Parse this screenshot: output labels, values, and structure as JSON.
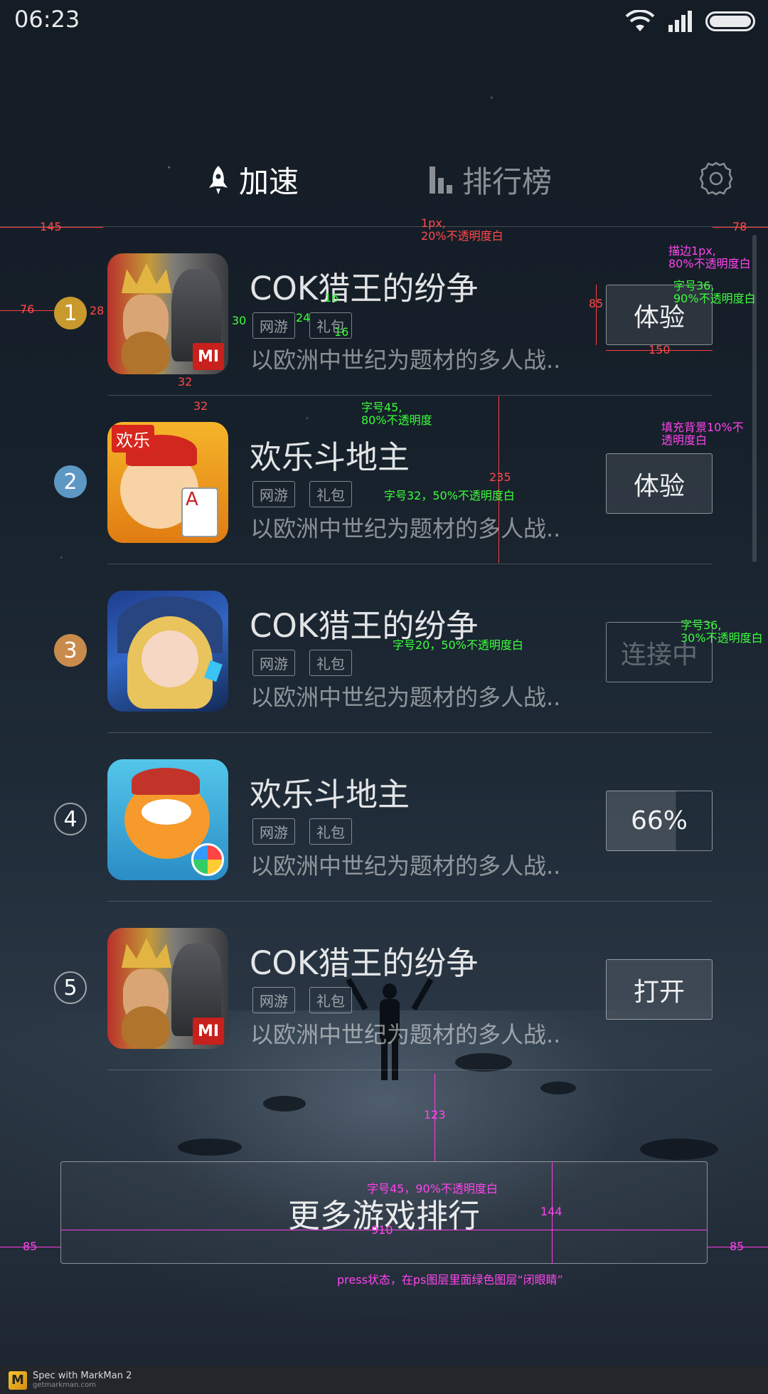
{
  "status_bar": {
    "time": "06:23"
  },
  "tabs": [
    {
      "label": "加速",
      "icon": "rocket-icon",
      "active": true
    },
    {
      "label": "排行榜",
      "icon": "bar-chart-icon",
      "active": false
    }
  ],
  "settings_icon": "gear-icon",
  "games": [
    {
      "rank": "1",
      "title": "COK猎王的纷争",
      "tags": [
        "网游",
        "礼包"
      ],
      "desc": "以欧洲中世纪为题材的多人战..",
      "button": "体验",
      "icon": "cok-game-icon"
    },
    {
      "rank": "2",
      "title": "欢乐斗地主",
      "tags": [
        "网游",
        "礼包"
      ],
      "desc": "以欧洲中世纪为题材的多人战..",
      "button": "体验",
      "icon": "doudizhu-game-icon"
    },
    {
      "rank": "3",
      "title": "COK猎王的纷争",
      "tags": [
        "网游",
        "礼包"
      ],
      "desc": "以欧洲中世纪为题材的多人战..",
      "button": "连接中",
      "icon": "hero-game-icon"
    },
    {
      "rank": "4",
      "title": "欢乐斗地主",
      "tags": [
        "网游",
        "礼包"
      ],
      "desc": "以欧洲中世纪为题材的多人战..",
      "button": "66%",
      "progress": 0.66,
      "icon": "cat-game-icon"
    },
    {
      "rank": "5",
      "title": "COK猎王的纷争",
      "tags": [
        "网游",
        "礼包"
      ],
      "desc": "以欧洲中世纪为题材的多人战..",
      "button": "打开",
      "icon": "cok-game-icon"
    }
  ],
  "more_button": "更多游戏排行",
  "annotations": {
    "m145": "145",
    "m1px": "1px,\n20%不透明度白",
    "m78": "78",
    "m_stroke": "描边1px,\n80%不透明度白",
    "m_font36_90": "字号36,\n90%不透明度白",
    "m85": "85",
    "m76": "76",
    "m28": "28",
    "m30": "30",
    "m24": "24",
    "m16a": "16",
    "m16b": "16",
    "m150": "150",
    "m32a": "32",
    "m32b": "32",
    "m_font45_80": "字号45,\n80%不透明度",
    "m_fill10": "填充背景10%不\n透明度白",
    "m235": "235",
    "m_font32_50": "字号32，50%不透明度白",
    "m_font20_50": "字号20，50%不透明度白",
    "m_font36_30": "字号36,\n30%不透明度白",
    "m123": "123",
    "m_font45_90": "字号45，90%不透明度白",
    "m144": "144",
    "m910": "910",
    "m85l": "85",
    "m85r": "85",
    "m_press": "press状态，在ps图层里面绿色图层“闭眼睛”"
  },
  "footer": {
    "brand": "Spec with MarkMan 2",
    "url": "getmarkman.com"
  }
}
